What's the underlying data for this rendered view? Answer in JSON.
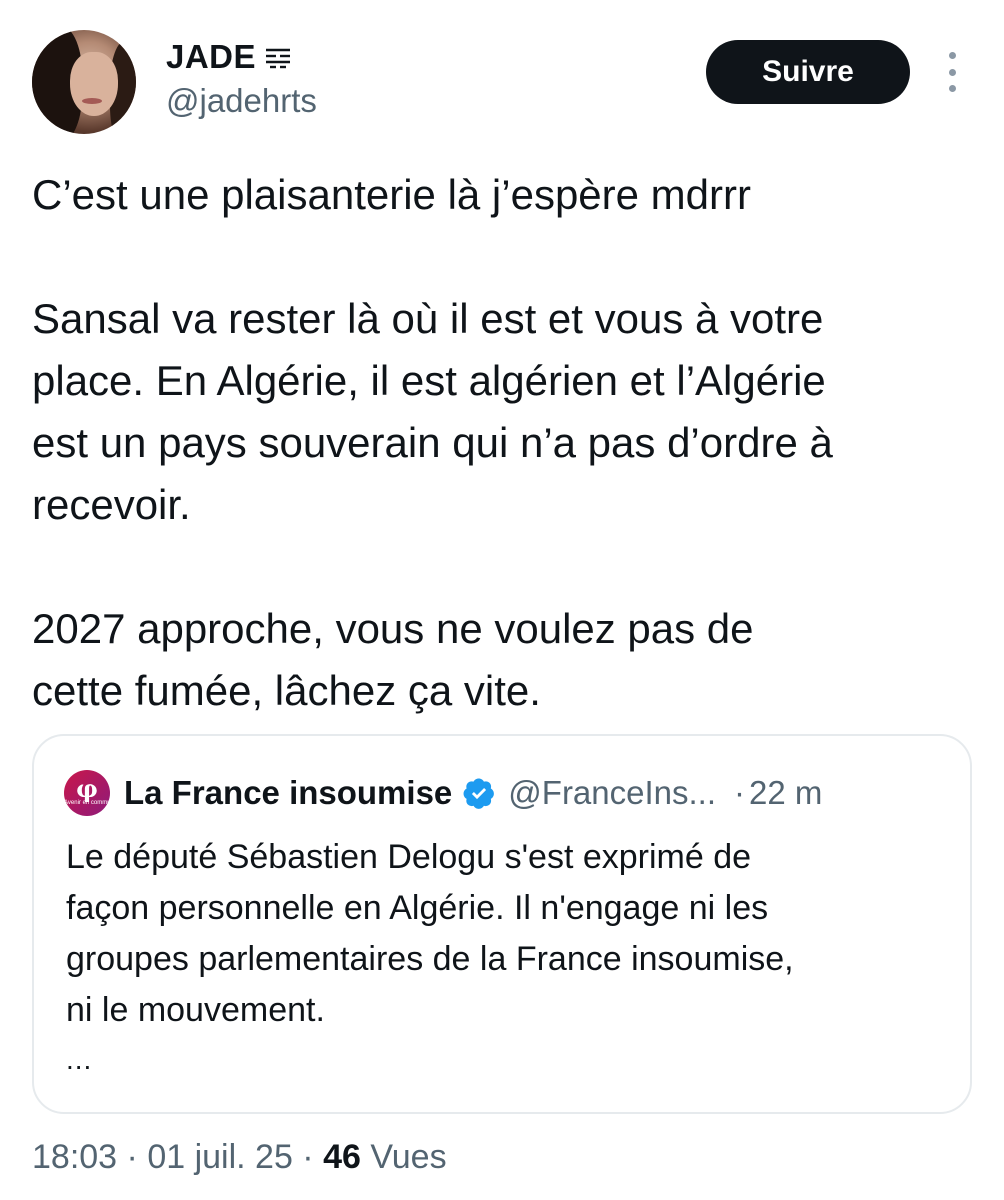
{
  "author": {
    "display_name": "JADE",
    "name_badge_icon": "broken-heart-lines-icon",
    "handle": "@jadehrts"
  },
  "header": {
    "follow_label": "Suivre",
    "more_icon": "vertical-ellipsis-icon"
  },
  "tweet": {
    "lines": [
      "C’est une plaisanterie là j’espère mdrrr",
      "",
      "Sansal va rester là où il est et vous à votre",
      "place. En Algérie, il est algérien et l’Algérie",
      "est un pays souverain qui n’a pas d’ordre à",
      "recevoir.",
      "",
      "2027 approche, vous ne voulez pas de",
      "cette fumée, lâchez ça vite."
    ]
  },
  "quote": {
    "logo_text": "φ",
    "logo_caption": "Avenir en commun",
    "name": "La France insoumise",
    "verified_icon": "verified-badge-icon",
    "handle": "@FranceIns...",
    "separator": "·",
    "time": "22 m",
    "lines": [
      "Le député Sébastien Delogu s'est exprimé de",
      "façon personnelle en Algérie. Il n'engage ni les",
      "groupes parlementaires de la France insoumise,",
      "ni le mouvement."
    ],
    "ellipsis": "..."
  },
  "meta": {
    "time": "18:03",
    "sep1": " · ",
    "date": "01 juil. 25",
    "sep2": " · ",
    "views_count": "46",
    "views_label": " Vues"
  },
  "colors": {
    "text": "#0f1419",
    "secondary": "#536471",
    "border": "#e6eaed",
    "verified": "#1d9bf0",
    "button_bg": "#0f1419"
  }
}
